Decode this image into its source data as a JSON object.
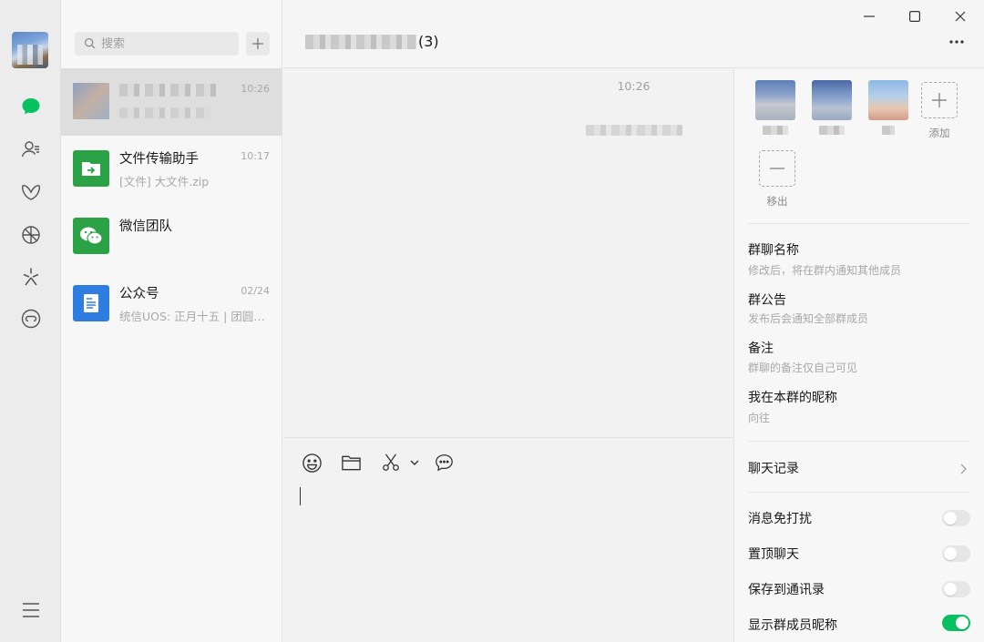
{
  "window": {
    "controls": [
      "minimize",
      "maximize",
      "close"
    ]
  },
  "rail": {
    "icons": [
      "chat-icon",
      "contacts-icon",
      "favorites-icon",
      "moments-icon",
      "channels-icon",
      "mini-programs-icon",
      "menu-icon"
    ],
    "accent": "#07c160"
  },
  "search": {
    "placeholder": "搜索"
  },
  "chats": [
    {
      "name": "",
      "time": "10:26",
      "message": "",
      "active": true
    },
    {
      "name": "文件传输助手",
      "time": "10:17",
      "message": "[文件] 大文件.zip",
      "active": false
    },
    {
      "name": "微信团队",
      "time": "",
      "message": "",
      "active": false
    },
    {
      "name": "公众号",
      "time": "02/24",
      "message": "统信UOS: 正月十五 | 团圆…",
      "active": false
    }
  ],
  "conversation": {
    "title_count": "(3)",
    "message_time": "10:26"
  },
  "panel": {
    "add_label": "添加",
    "remove_label": "移出",
    "group_name": {
      "title": "群聊名称",
      "sub": "修改后，将在群内通知其他成员"
    },
    "announcement": {
      "title": "群公告",
      "sub": "发布后会通知全部群成员"
    },
    "remark": {
      "title": "备注",
      "sub": "群聊的备注仅自己可见"
    },
    "my_nickname": {
      "title": "我在本群的昵称",
      "sub": "向往"
    },
    "history": "聊天记录",
    "toggles": [
      {
        "label": "消息免打扰",
        "on": false
      },
      {
        "label": "置顶聊天",
        "on": false
      },
      {
        "label": "保存到通讯录",
        "on": false
      },
      {
        "label": "显示群成员昵称",
        "on": true
      }
    ]
  }
}
